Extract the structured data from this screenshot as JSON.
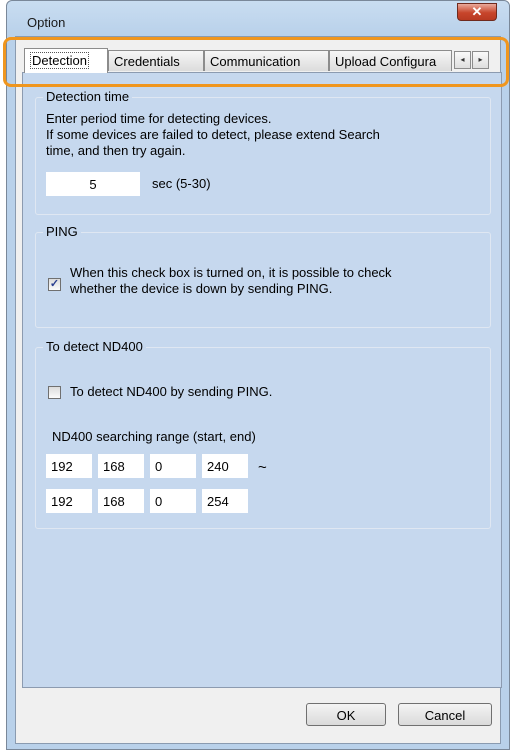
{
  "window": {
    "title": "Option",
    "close_glyph": "✕"
  },
  "tabs": {
    "items": [
      {
        "label": "Detection"
      },
      {
        "label": "Credentials"
      },
      {
        "label": "Communication"
      },
      {
        "label": "Upload Configura"
      }
    ],
    "scroll_left": "◂",
    "scroll_right": "▸"
  },
  "detection_time": {
    "title": "Detection time",
    "line1": "Enter period time for detecting devices.",
    "line2": "If some devices are failed to detect, please extend Search",
    "line3": "time, and then try again.",
    "value": "5",
    "unit": "sec (5-30)"
  },
  "ping": {
    "title": "PING",
    "checked": true,
    "check_glyph": "✓",
    "line1": "When this check box is turned on, it is possible to check",
    "line2": "whether the device is down by sending PING."
  },
  "nd400": {
    "title": "To detect ND400",
    "checkbox_label": "To detect ND400 by sending PING.",
    "checked": false,
    "range_label": "ND400 searching range (start, end)",
    "start": [
      "192",
      "168",
      "0",
      "240"
    ],
    "end": [
      "192",
      "168",
      "0",
      "254"
    ],
    "separator": "~"
  },
  "buttons": {
    "ok": "OK",
    "cancel": "Cancel"
  },
  "colors": {
    "highlight": "#f0961e",
    "page_bg": "#c6d8ee",
    "frame": "#b9d1ea"
  }
}
